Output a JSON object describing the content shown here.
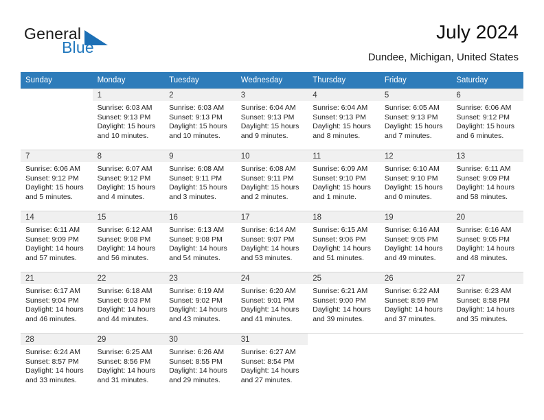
{
  "brand": {
    "name_general": "General",
    "name_blue": "Blue",
    "accent_color": "#1c6fb5"
  },
  "header": {
    "title": "July 2024",
    "subtitle": "Dundee, Michigan, United States"
  },
  "calendar": {
    "header_bg": "#2e7cba",
    "weekday_headers": [
      "Sunday",
      "Monday",
      "Tuesday",
      "Wednesday",
      "Thursday",
      "Friday",
      "Saturday"
    ],
    "weeks": [
      [
        {
          "day": "",
          "sunrise": "",
          "sunset": "",
          "daylight_line1": "",
          "daylight_line2": ""
        },
        {
          "day": "1",
          "sunrise": "Sunrise: 6:03 AM",
          "sunset": "Sunset: 9:13 PM",
          "daylight_line1": "Daylight: 15 hours",
          "daylight_line2": "and 10 minutes."
        },
        {
          "day": "2",
          "sunrise": "Sunrise: 6:03 AM",
          "sunset": "Sunset: 9:13 PM",
          "daylight_line1": "Daylight: 15 hours",
          "daylight_line2": "and 10 minutes."
        },
        {
          "day": "3",
          "sunrise": "Sunrise: 6:04 AM",
          "sunset": "Sunset: 9:13 PM",
          "daylight_line1": "Daylight: 15 hours",
          "daylight_line2": "and 9 minutes."
        },
        {
          "day": "4",
          "sunrise": "Sunrise: 6:04 AM",
          "sunset": "Sunset: 9:13 PM",
          "daylight_line1": "Daylight: 15 hours",
          "daylight_line2": "and 8 minutes."
        },
        {
          "day": "5",
          "sunrise": "Sunrise: 6:05 AM",
          "sunset": "Sunset: 9:13 PM",
          "daylight_line1": "Daylight: 15 hours",
          "daylight_line2": "and 7 minutes."
        },
        {
          "day": "6",
          "sunrise": "Sunrise: 6:06 AM",
          "sunset": "Sunset: 9:12 PM",
          "daylight_line1": "Daylight: 15 hours",
          "daylight_line2": "and 6 minutes."
        }
      ],
      [
        {
          "day": "7",
          "sunrise": "Sunrise: 6:06 AM",
          "sunset": "Sunset: 9:12 PM",
          "daylight_line1": "Daylight: 15 hours",
          "daylight_line2": "and 5 minutes."
        },
        {
          "day": "8",
          "sunrise": "Sunrise: 6:07 AM",
          "sunset": "Sunset: 9:12 PM",
          "daylight_line1": "Daylight: 15 hours",
          "daylight_line2": "and 4 minutes."
        },
        {
          "day": "9",
          "sunrise": "Sunrise: 6:08 AM",
          "sunset": "Sunset: 9:11 PM",
          "daylight_line1": "Daylight: 15 hours",
          "daylight_line2": "and 3 minutes."
        },
        {
          "day": "10",
          "sunrise": "Sunrise: 6:08 AM",
          "sunset": "Sunset: 9:11 PM",
          "daylight_line1": "Daylight: 15 hours",
          "daylight_line2": "and 2 minutes."
        },
        {
          "day": "11",
          "sunrise": "Sunrise: 6:09 AM",
          "sunset": "Sunset: 9:10 PM",
          "daylight_line1": "Daylight: 15 hours",
          "daylight_line2": "and 1 minute."
        },
        {
          "day": "12",
          "sunrise": "Sunrise: 6:10 AM",
          "sunset": "Sunset: 9:10 PM",
          "daylight_line1": "Daylight: 15 hours",
          "daylight_line2": "and 0 minutes."
        },
        {
          "day": "13",
          "sunrise": "Sunrise: 6:11 AM",
          "sunset": "Sunset: 9:09 PM",
          "daylight_line1": "Daylight: 14 hours",
          "daylight_line2": "and 58 minutes."
        }
      ],
      [
        {
          "day": "14",
          "sunrise": "Sunrise: 6:11 AM",
          "sunset": "Sunset: 9:09 PM",
          "daylight_line1": "Daylight: 14 hours",
          "daylight_line2": "and 57 minutes."
        },
        {
          "day": "15",
          "sunrise": "Sunrise: 6:12 AM",
          "sunset": "Sunset: 9:08 PM",
          "daylight_line1": "Daylight: 14 hours",
          "daylight_line2": "and 56 minutes."
        },
        {
          "day": "16",
          "sunrise": "Sunrise: 6:13 AM",
          "sunset": "Sunset: 9:08 PM",
          "daylight_line1": "Daylight: 14 hours",
          "daylight_line2": "and 54 minutes."
        },
        {
          "day": "17",
          "sunrise": "Sunrise: 6:14 AM",
          "sunset": "Sunset: 9:07 PM",
          "daylight_line1": "Daylight: 14 hours",
          "daylight_line2": "and 53 minutes."
        },
        {
          "day": "18",
          "sunrise": "Sunrise: 6:15 AM",
          "sunset": "Sunset: 9:06 PM",
          "daylight_line1": "Daylight: 14 hours",
          "daylight_line2": "and 51 minutes."
        },
        {
          "day": "19",
          "sunrise": "Sunrise: 6:16 AM",
          "sunset": "Sunset: 9:05 PM",
          "daylight_line1": "Daylight: 14 hours",
          "daylight_line2": "and 49 minutes."
        },
        {
          "day": "20",
          "sunrise": "Sunrise: 6:16 AM",
          "sunset": "Sunset: 9:05 PM",
          "daylight_line1": "Daylight: 14 hours",
          "daylight_line2": "and 48 minutes."
        }
      ],
      [
        {
          "day": "21",
          "sunrise": "Sunrise: 6:17 AM",
          "sunset": "Sunset: 9:04 PM",
          "daylight_line1": "Daylight: 14 hours",
          "daylight_line2": "and 46 minutes."
        },
        {
          "day": "22",
          "sunrise": "Sunrise: 6:18 AM",
          "sunset": "Sunset: 9:03 PM",
          "daylight_line1": "Daylight: 14 hours",
          "daylight_line2": "and 44 minutes."
        },
        {
          "day": "23",
          "sunrise": "Sunrise: 6:19 AM",
          "sunset": "Sunset: 9:02 PM",
          "daylight_line1": "Daylight: 14 hours",
          "daylight_line2": "and 43 minutes."
        },
        {
          "day": "24",
          "sunrise": "Sunrise: 6:20 AM",
          "sunset": "Sunset: 9:01 PM",
          "daylight_line1": "Daylight: 14 hours",
          "daylight_line2": "and 41 minutes."
        },
        {
          "day": "25",
          "sunrise": "Sunrise: 6:21 AM",
          "sunset": "Sunset: 9:00 PM",
          "daylight_line1": "Daylight: 14 hours",
          "daylight_line2": "and 39 minutes."
        },
        {
          "day": "26",
          "sunrise": "Sunrise: 6:22 AM",
          "sunset": "Sunset: 8:59 PM",
          "daylight_line1": "Daylight: 14 hours",
          "daylight_line2": "and 37 minutes."
        },
        {
          "day": "27",
          "sunrise": "Sunrise: 6:23 AM",
          "sunset": "Sunset: 8:58 PM",
          "daylight_line1": "Daylight: 14 hours",
          "daylight_line2": "and 35 minutes."
        }
      ],
      [
        {
          "day": "28",
          "sunrise": "Sunrise: 6:24 AM",
          "sunset": "Sunset: 8:57 PM",
          "daylight_line1": "Daylight: 14 hours",
          "daylight_line2": "and 33 minutes."
        },
        {
          "day": "29",
          "sunrise": "Sunrise: 6:25 AM",
          "sunset": "Sunset: 8:56 PM",
          "daylight_line1": "Daylight: 14 hours",
          "daylight_line2": "and 31 minutes."
        },
        {
          "day": "30",
          "sunrise": "Sunrise: 6:26 AM",
          "sunset": "Sunset: 8:55 PM",
          "daylight_line1": "Daylight: 14 hours",
          "daylight_line2": "and 29 minutes."
        },
        {
          "day": "31",
          "sunrise": "Sunrise: 6:27 AM",
          "sunset": "Sunset: 8:54 PM",
          "daylight_line1": "Daylight: 14 hours",
          "daylight_line2": "and 27 minutes."
        },
        {
          "day": "",
          "sunrise": "",
          "sunset": "",
          "daylight_line1": "",
          "daylight_line2": ""
        },
        {
          "day": "",
          "sunrise": "",
          "sunset": "",
          "daylight_line1": "",
          "daylight_line2": ""
        },
        {
          "day": "",
          "sunrise": "",
          "sunset": "",
          "daylight_line1": "",
          "daylight_line2": ""
        }
      ]
    ]
  }
}
